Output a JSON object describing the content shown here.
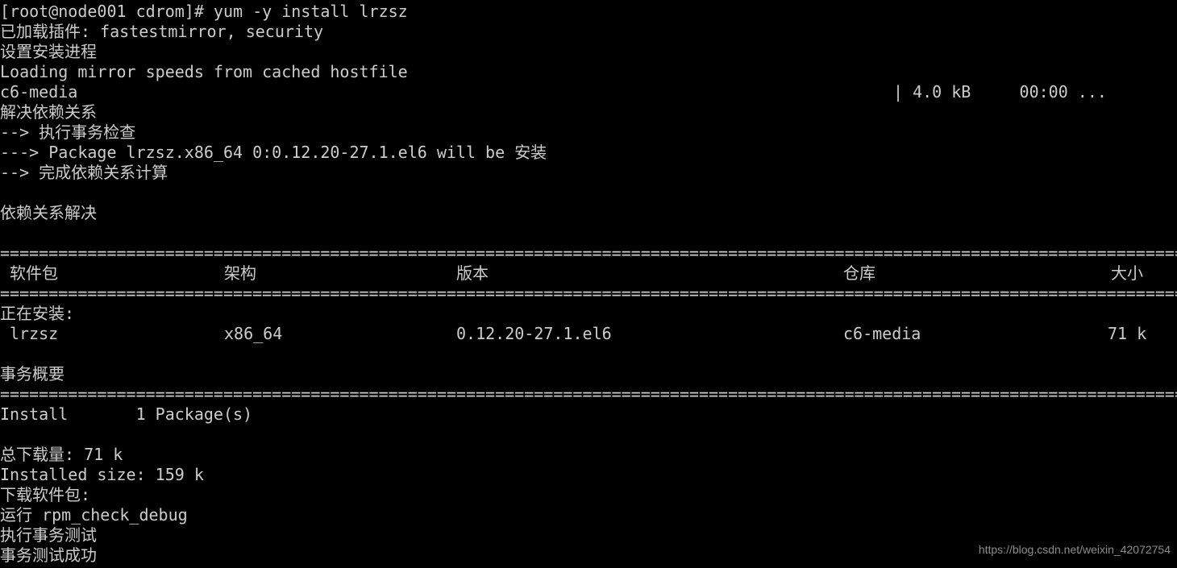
{
  "terminal": {
    "background_color": "#000000",
    "text_color": "#cccccc",
    "prompt_line": "[root@node001 cdrom]# yum -y install lrzsz",
    "lines": [
      "已加载插件: fastestmirror, security",
      "设置安装进程",
      "Loading mirror speeds from cached hostfile"
    ],
    "repo_line": {
      "name": "c6-media",
      "progress": "| 4.0 kB     00:00 ..."
    },
    "resolve_lines": [
      "解决依赖关系",
      "--> 执行事务检查",
      "---> Package lrzsz.x86_64 0:0.12.20-27.1.el6 will be 安装",
      "--> 完成依赖关系计算"
    ],
    "resolved_line": "依赖关系解决",
    "separator": "=",
    "table": {
      "headers": {
        "package": "软件包",
        "arch": "架构",
        "version": "版本",
        "repository": "仓库",
        "size": "大小"
      },
      "section_label": "正在安装:",
      "rows": [
        {
          "package": "lrzsz",
          "arch": "x86_64",
          "version": "0.12.20-27.1.el6",
          "repository": "c6-media",
          "size": "71 k"
        }
      ]
    },
    "summary_title": "事务概要",
    "summary_line": "Install       1 Package(s)",
    "footer_lines": [
      "总下载量: 71 k",
      "Installed size: 159 k",
      "下载软件包:",
      "运行 rpm_check_debug",
      "执行事务测试",
      "事务测试成功"
    ]
  },
  "watermark": {
    "text": "https://blog.csdn.net/weixin_42072754"
  }
}
